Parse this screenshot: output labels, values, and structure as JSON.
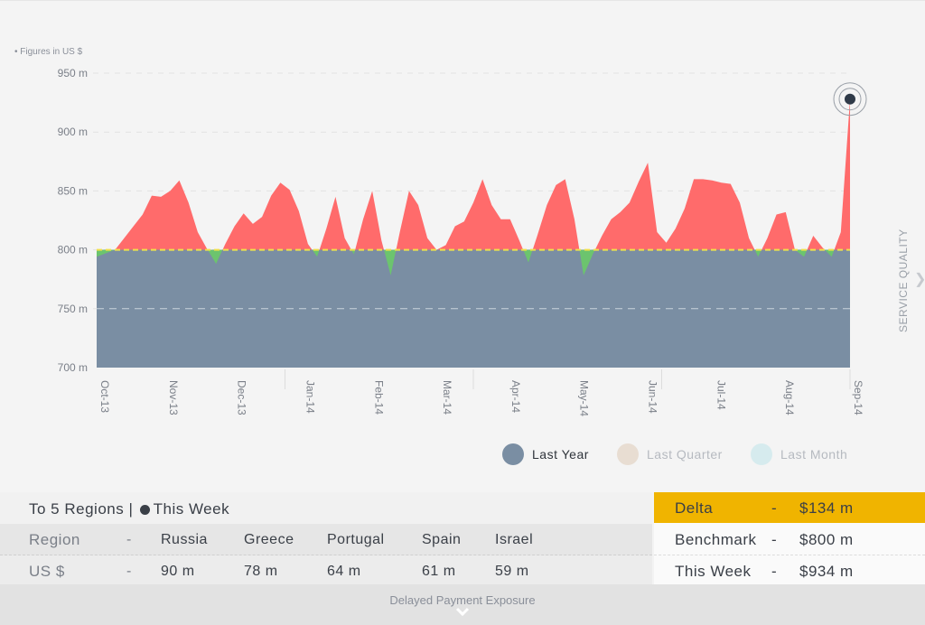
{
  "chart_note": "• Figures in US $",
  "side_label": "SERVICE QUALITY",
  "chart_data": {
    "type": "area",
    "ylim": [
      700,
      950
    ],
    "yticks": [
      700,
      750,
      800,
      850,
      900,
      950
    ],
    "ytick_labels": [
      "700 m",
      "750 m",
      "800 m",
      "850 m",
      "900 m",
      "950 m"
    ],
    "xtick_labels": [
      "Oct-13",
      "Nov-13",
      "Dec-13",
      "Jan-14",
      "Feb-14",
      "Mar-14",
      "Apr-14",
      "May-14",
      "Jun-14",
      "Jul-14",
      "Aug-14",
      "Sep-14"
    ],
    "baseline": 800,
    "values": [
      794,
      797,
      800,
      810,
      820,
      830,
      846,
      845,
      850,
      859,
      840,
      815,
      801,
      788,
      805,
      820,
      831,
      822,
      828,
      846,
      857,
      851,
      833,
      805,
      794,
      818,
      845,
      810,
      796,
      826,
      850,
      808,
      778,
      815,
      850,
      838,
      810,
      800,
      804,
      820,
      824,
      840,
      860,
      838,
      826,
      826,
      808,
      789,
      813,
      838,
      855,
      860,
      826,
      778,
      796,
      812,
      826,
      832,
      840,
      858,
      874,
      815,
      806,
      818,
      835,
      860,
      860,
      859,
      857,
      856,
      840,
      810,
      794,
      810,
      830,
      832,
      800,
      794,
      812,
      802,
      794,
      815,
      928
    ],
    "highlight_value": 928,
    "colors": {
      "baseline_fill": "#7a8ea3",
      "above": "#ff6b6b",
      "below": "#6cc46e",
      "baseline_line": "#f0e14a"
    }
  },
  "legend": [
    {
      "label": "Last Year",
      "color": "#7a8ea3",
      "active": true
    },
    {
      "label": "Last Quarter",
      "color": "#e8ddd2",
      "active": false
    },
    {
      "label": "Last Month",
      "color": "#d6ebee",
      "active": false
    }
  ],
  "regions": {
    "title": "To 5 Regions |",
    "title_suffix": "This Week",
    "header_label": "Region",
    "value_label": "US $",
    "dash": "-",
    "names": [
      "Russia",
      "Greece",
      "Portugal",
      "Spain",
      "Israel"
    ],
    "values": [
      "90 m",
      "78 m",
      "64 m",
      "61 m",
      "59 m"
    ]
  },
  "stats": {
    "delta": {
      "label": "Delta",
      "dash": "-",
      "value": "$134 m"
    },
    "benchmark": {
      "label": "Benchmark",
      "dash": "-",
      "value": "$800 m"
    },
    "this_week": {
      "label": "This Week",
      "dash": "-",
      "value": "$934 m"
    }
  },
  "footer": {
    "label": "Delayed Payment Exposure"
  }
}
